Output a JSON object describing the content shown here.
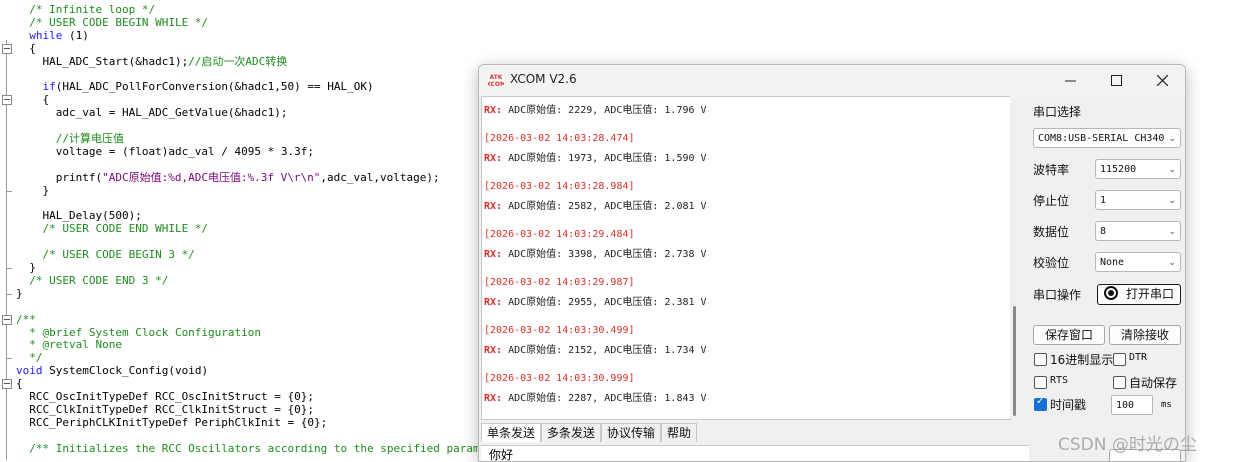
{
  "editor": {
    "lines": [
      "  /* Infinite loop */",
      "  /* USER CODE BEGIN WHILE */",
      "  while (1)",
      "  {",
      "    HAL_ADC_Start(&hadc1);//启动一次ADC转换",
      "",
      "    if(HAL_ADC_PollForConversion(&hadc1,50) == HAL_OK)",
      "    {",
      "      adc_val = HAL_ADC_GetValue(&hadc1);",
      "",
      "      //计算电压值",
      "      voltage = (float)adc_val / 4095 * 3.3f;",
      "",
      "      printf(\"ADC原始值:%d,ADC电压值:%.3f V\\r\\n\",adc_val,voltage);",
      "    }",
      "",
      "    HAL_Delay(500);",
      "    /* USER CODE END WHILE */",
      "",
      "    /* USER CODE BEGIN 3 */",
      "  }",
      "  /* USER CODE END 3 */",
      "}",
      "",
      "/**",
      "  * @brief System Clock Configuration",
      "  * @retval None",
      "  */",
      "void SystemClock_Config(void)",
      "{",
      "  RCC_OscInitTypeDef RCC_OscInitStruct = {0};",
      "  RCC_ClkInitTypeDef RCC_ClkInitStruct = {0};",
      "  RCC_PeriphCLKInitTypeDef PeriphClkInit = {0};",
      "",
      "  /** Initializes the RCC Oscillators according to the specified parameters"
    ]
  },
  "window": {
    "title": "XCOM V2.6",
    "logo_text": "ATK XCOM",
    "minimize_icon": "minimize-icon",
    "maximize_icon": "maximize-icon",
    "close_icon": "close-icon"
  },
  "receive": {
    "rx_prefix": "RX:",
    "entries": [
      {
        "timestamp": "",
        "text": " ADC原始值: 2229, ADC电压值: 1.796 V"
      },
      {
        "timestamp": "[2026-03-02 14:03:28.474]",
        "text": " ADC原始值: 1973, ADC电压值: 1.590 V"
      },
      {
        "timestamp": "[2026-03-02 14:03:28.984]",
        "text": " ADC原始值: 2582, ADC电压值: 2.081 V"
      },
      {
        "timestamp": "[2026-03-02 14:03:29.484]",
        "text": " ADC原始值: 3398, ADC电压值: 2.738 V"
      },
      {
        "timestamp": "[2026-03-02 14:03:29.987]",
        "text": " ADC原始值: 2955, ADC电压值: 2.381 V"
      },
      {
        "timestamp": "[2026-03-02 14:03:30.499]",
        "text": " ADC原始值: 2152, ADC电压值: 1.734 V"
      },
      {
        "timestamp": "[2026-03-02 14:03:30.999]",
        "text": " ADC原始值: 2287, ADC电压值: 1.843 V"
      }
    ]
  },
  "tabs": [
    "单条发送",
    "多条发送",
    "协议传输",
    "帮助"
  ],
  "send": {
    "value": "你好"
  },
  "settings": {
    "port_label": "串口选择",
    "port_value": "COM8:USB-SERIAL CH340",
    "baud_label": "波特率",
    "baud_value": "115200",
    "stop_label": "停止位",
    "stop_value": "1",
    "data_label": "数据位",
    "data_value": "8",
    "parity_label": "校验位",
    "parity_value": "None",
    "op_label": "串口操作",
    "open_label": "打开串口",
    "save_label": "保存窗口",
    "clear_label": "清除接收",
    "hex_label": "16进制显示",
    "dtr_label": "DTR",
    "rts_label": "RTS",
    "autosave_label": "自动保存",
    "timestamp_label": "时间戳",
    "timestamp_checked": true,
    "interval_value": "100",
    "interval_unit": "ms"
  },
  "watermark": "CSDN @时光の尘"
}
